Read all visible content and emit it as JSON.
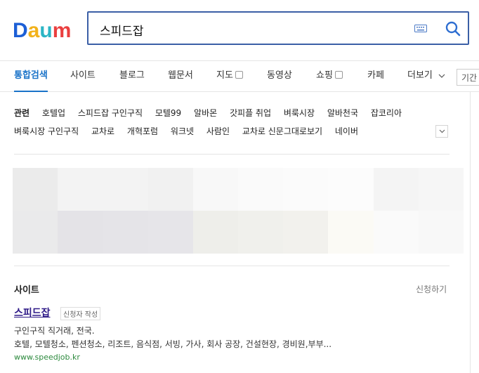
{
  "search": {
    "query": "스피드잡"
  },
  "logo": {
    "text": "Daum"
  },
  "tabs": [
    {
      "label": "통합검색",
      "active": true
    },
    {
      "label": "사이트"
    },
    {
      "label": "블로그"
    },
    {
      "label": "웹문서"
    },
    {
      "label": "지도",
      "has_box": true
    },
    {
      "label": "동영상"
    },
    {
      "label": "쇼핑",
      "has_box": true
    },
    {
      "label": "카페"
    },
    {
      "label": "더보기"
    }
  ],
  "period_button": "기간",
  "related": {
    "title": "관련",
    "row1": [
      "호텔업",
      "스피드잡 구인구직",
      "모텔99",
      "알바몬",
      "갓피플 취업",
      "벼룩시장",
      "알바천국",
      "잡코리아"
    ],
    "row2": [
      "벼룩시장 구인구직",
      "교차로",
      "개혁포럼",
      "워크넷",
      "사람인",
      "교차로 신문그대로보기",
      "네이버"
    ]
  },
  "site_section": {
    "heading": "사이트",
    "more": "신청하기",
    "title": "스피드잡",
    "badge": "신청자 작성",
    "desc1": "구인구직 직거래, 전국.",
    "desc2": "호텔, 모텔청소, 펜션청소, 리조트, 음식점, 서빙, 가사, 회사 공장, 건설현장, 경비원,부부...",
    "url": "www.speedjob.kr"
  },
  "colors": {
    "accent": "#1a73c8",
    "search_border": "#3b5fa6",
    "link_visited": "#2e1a87",
    "url_green": "#2d8a3e"
  },
  "image_tiles": [
    "#ebebeb",
    "#f3f3f3",
    "#f3f3f3",
    "#f1f1f1",
    "#f8f8f8",
    "#fafafa",
    "#fbfbfb",
    "#fcfcfc",
    "#f4f4f4",
    "#f6f6f6",
    "#eaeaeb",
    "#e4e3e7",
    "#e5e4e8",
    "#e6e5e9",
    "#eeeeea",
    "#f0f0ec",
    "#f2f1ed",
    "#fbfaf5",
    "#fafafa",
    "#f8f8f8"
  ]
}
